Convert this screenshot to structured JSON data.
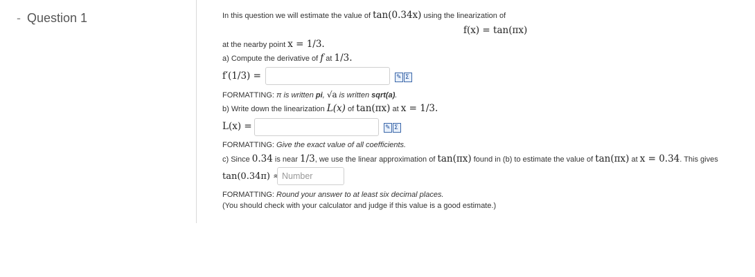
{
  "question": {
    "dash": "-",
    "title": "Question 1"
  },
  "intro": {
    "text1": "In this question we will estimate the value of ",
    "expr1": "tan(0.34x)",
    "text2": " using the linearization of",
    "function": "f(x) = tan(πx)",
    "nearby_prefix": "at the nearby point ",
    "nearby_point": "x = 1/3."
  },
  "part_a": {
    "prompt_prefix": "a) Compute the derivative of ",
    "prompt_f": "f",
    "prompt_mid": " at ",
    "prompt_point": "1/3.",
    "label": "f′(1/3) =",
    "input_value": "",
    "formatting_label": "FORMATTING: ",
    "formatting_text1": "π is written ",
    "formatting_pi": "pi",
    "formatting_text2": ", ",
    "formatting_sqrt": "√a",
    "formatting_text3": " is written ",
    "formatting_sqrt_code": "sqrt(a)",
    "formatting_end": "."
  },
  "part_b": {
    "prompt_prefix": "b) Write down the linearization ",
    "prompt_L": "L(x)",
    "prompt_mid": " of ",
    "prompt_fn": "tan(πx)",
    "prompt_at": " at ",
    "prompt_point": "x = 1/3.",
    "label": "L(x) =",
    "input_value": "",
    "formatting_label": "FORMATTING: ",
    "formatting_text": "Give the exact value of all coefficients."
  },
  "part_c": {
    "t1": "c) Since ",
    "v1": "0.34",
    "t2": " is near ",
    "v2": "1/3",
    "t3": ", we use the linear approximation of ",
    "v3": "tan(πx)",
    "t4": " found in (b) to estimate the value of ",
    "v4": "tan(πx)",
    "t5": " at ",
    "v5": "x = 0.34",
    "t6": ". This gives",
    "label": "tan(0.34π) ≈",
    "placeholder": "Number",
    "formatting_label": "FORMATTING: ",
    "formatting_text": "Round your answer to at least six decimal places.",
    "note": "(You should check with your calculator and judge if this value is a good estimate.)"
  },
  "icons": [
    "formula-editor-icon",
    "sigma-icon"
  ]
}
